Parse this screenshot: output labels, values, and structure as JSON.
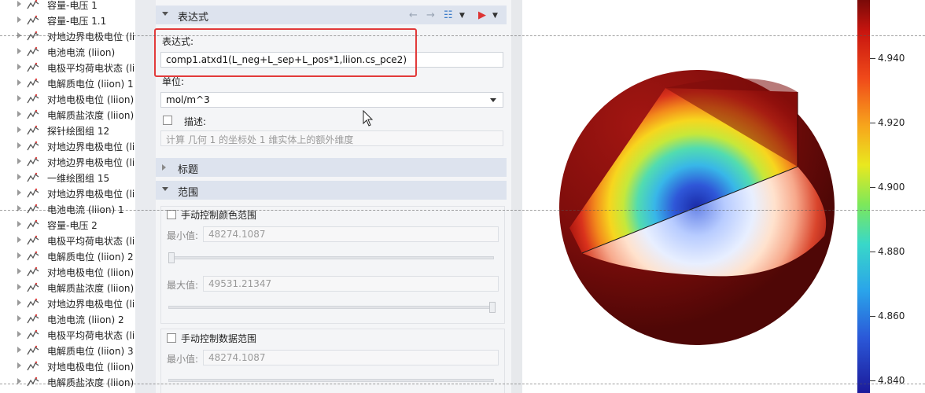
{
  "tree": {
    "items": [
      {
        "label": "容量-电压 1",
        "icon": "plot-icon"
      },
      {
        "label": "容量-电压 1.1",
        "icon": "plot-icon"
      },
      {
        "label": "对地边界电极电位 (li",
        "icon": "plot-icon"
      },
      {
        "label": "电池电流 (liion)",
        "icon": "plot-icon"
      },
      {
        "label": "电极平均荷电状态 (li",
        "icon": "plot-icon"
      },
      {
        "label": "电解质电位 (liion) 1",
        "icon": "plot-icon"
      },
      {
        "label": "对地电极电位 (liion)",
        "icon": "plot-icon"
      },
      {
        "label": "电解质盐浓度 (liion)",
        "icon": "plot-icon"
      },
      {
        "label": "探针绘图组 12",
        "icon": "plot-icon"
      },
      {
        "label": "对地边界电极电位 (li",
        "icon": "plot-icon"
      },
      {
        "label": "对地边界电极电位 (li",
        "icon": "plot-icon"
      },
      {
        "label": "一维绘图组 15",
        "icon": "plot-icon"
      },
      {
        "label": "对地边界电极电位 (li",
        "icon": "plot-icon"
      },
      {
        "label": "电池电流 (liion) 1",
        "icon": "plot-icon"
      },
      {
        "label": "容量-电压 2",
        "icon": "plot-icon"
      },
      {
        "label": "电极平均荷电状态 (li",
        "icon": "plot-icon"
      },
      {
        "label": "电解质电位 (liion) 2",
        "icon": "plot-icon"
      },
      {
        "label": "对地电极电位 (liion)",
        "icon": "plot-icon"
      },
      {
        "label": "电解质盐浓度 (liion)",
        "icon": "plot-icon"
      },
      {
        "label": "对地边界电极电位 (li",
        "icon": "plot-icon"
      },
      {
        "label": "电池电流 (liion) 2",
        "icon": "plot-icon"
      },
      {
        "label": "电极平均荷电状态 (li",
        "icon": "plot-icon"
      },
      {
        "label": "电解质电位 (liion) 3",
        "icon": "plot-icon"
      },
      {
        "label": "对地电极电位 (liion)",
        "icon": "plot-icon"
      },
      {
        "label": "电解质盐浓度 (liion)",
        "icon": "plot-icon"
      }
    ]
  },
  "expression_section": {
    "title": "表达式",
    "expression_label": "表达式:",
    "expression_value": "comp1.atxd1(L_neg+L_sep+L_pos*1,liion.cs_pce2)",
    "unit_label": "单位:",
    "unit_value": "mol/m^3",
    "description_label": "描述:",
    "description_value": "计算 几何 1 的坐标处 1 维实体上的额外维度"
  },
  "title_section": {
    "title": "标题"
  },
  "range_section": {
    "title": "范围",
    "manual_color_label": "手动控制颜色范围",
    "min_label": "最小值:",
    "min_value": "48274.1087",
    "max_label": "最大值:",
    "max_value": "49531.21347",
    "manual_data_label": "手动控制数据范围",
    "min2_label": "最小值:",
    "min2_value": "48274.1087"
  },
  "legend": {
    "labels": [
      "4.940",
      "4.920",
      "4.900",
      "4.880",
      "4.860",
      "4.840"
    ]
  },
  "colors": {
    "highlight": "#e23a3a",
    "section_header": "#dde3ee"
  }
}
